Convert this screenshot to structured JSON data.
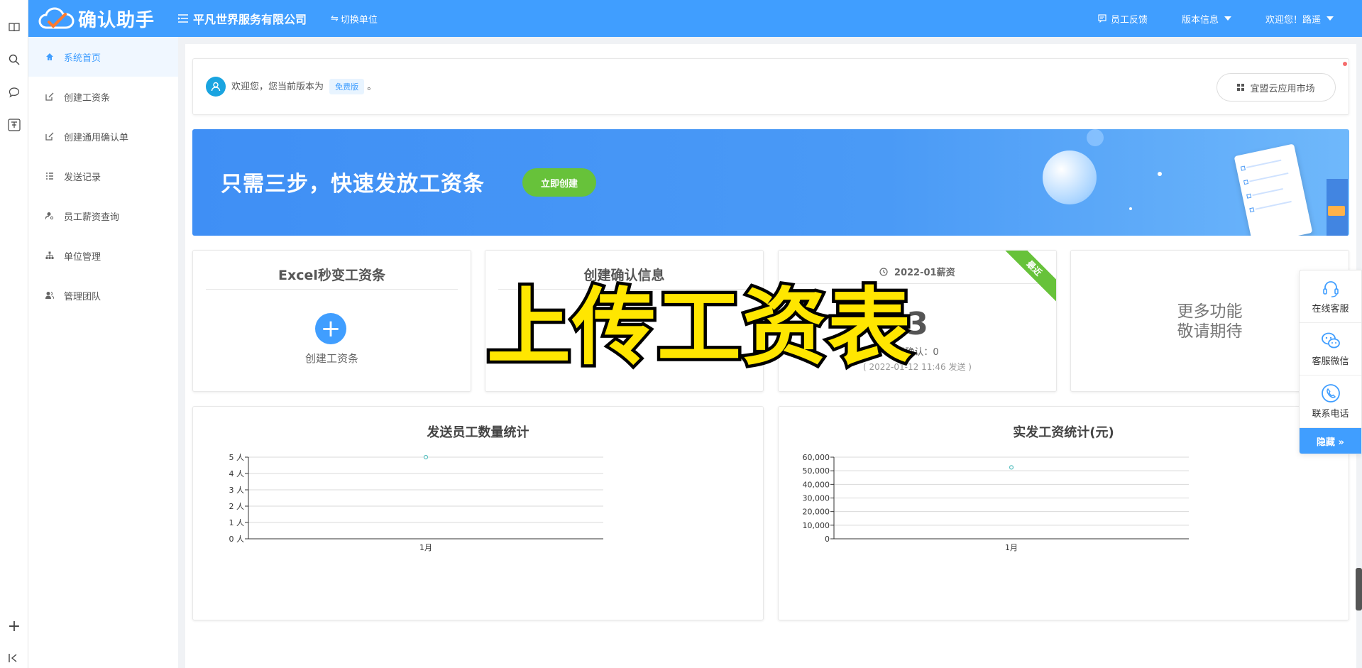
{
  "app": {
    "logo_text": "确认助手",
    "company": "平凡世界服务有限公司",
    "switch_unit": "切换单位"
  },
  "topbar": {
    "feedback": "员工反馈",
    "version": "版本信息",
    "welcome_user": "欢迎您！路遥"
  },
  "sidebar": {
    "items": [
      {
        "label": "系统首页",
        "icon": "home-icon",
        "active": true
      },
      {
        "label": "创建工资条",
        "icon": "edit-icon"
      },
      {
        "label": "创建通用确认单",
        "icon": "edit-icon"
      },
      {
        "label": "发送记录",
        "icon": "list-icon"
      },
      {
        "label": "员工薪资查询",
        "icon": "user-search-icon"
      },
      {
        "label": "单位管理",
        "icon": "org-icon"
      },
      {
        "label": "管理团队",
        "icon": "team-icon"
      }
    ]
  },
  "welcome": {
    "text": "欢迎您，您当前版本为",
    "version_badge": "免费版",
    "suffix": "。",
    "market_button": "宜盟云应用市场"
  },
  "banner": {
    "title": "只需三步，快速发放工资条",
    "button": "立即创建"
  },
  "cards": {
    "excel": {
      "title": "Excel秒变工资条",
      "action": "创建工资条"
    },
    "confirm": {
      "title": "创建确认信息"
    },
    "salary": {
      "period": "2022-01薪资",
      "ribbon": "最近",
      "count": "3",
      "confirmed": "已确认：0",
      "sent_time": "( 2022-01-12 11:46 发送 )"
    },
    "more": {
      "line1": "更多功能",
      "line2": "敬请期待"
    }
  },
  "overlay_text": "上传工资表",
  "float_panel": {
    "online": "在线客服",
    "wechat": "客服微信",
    "phone": "联系电话",
    "hide": "隐藏 »"
  },
  "chart_data": [
    {
      "type": "line",
      "title": "发送员工数量统计",
      "categories": [
        "1月"
      ],
      "series": [
        {
          "values": [
            5
          ]
        }
      ],
      "yticks": [
        "0 人",
        "1 人",
        "2 人",
        "3 人",
        "4 人",
        "5 人"
      ],
      "ylim": [
        0,
        5
      ],
      "grid": true,
      "color": "#5bc0c0"
    },
    {
      "type": "line",
      "title": "实发工资统计(元)",
      "categories": [
        "1月"
      ],
      "series": [
        {
          "values": [
            52500
          ]
        }
      ],
      "yticks": [
        "0",
        "10,000",
        "20,000",
        "30,000",
        "40,000",
        "50,000",
        "60,000"
      ],
      "ylim": [
        0,
        60000
      ],
      "grid": true,
      "color": "#5bc0c0"
    }
  ]
}
